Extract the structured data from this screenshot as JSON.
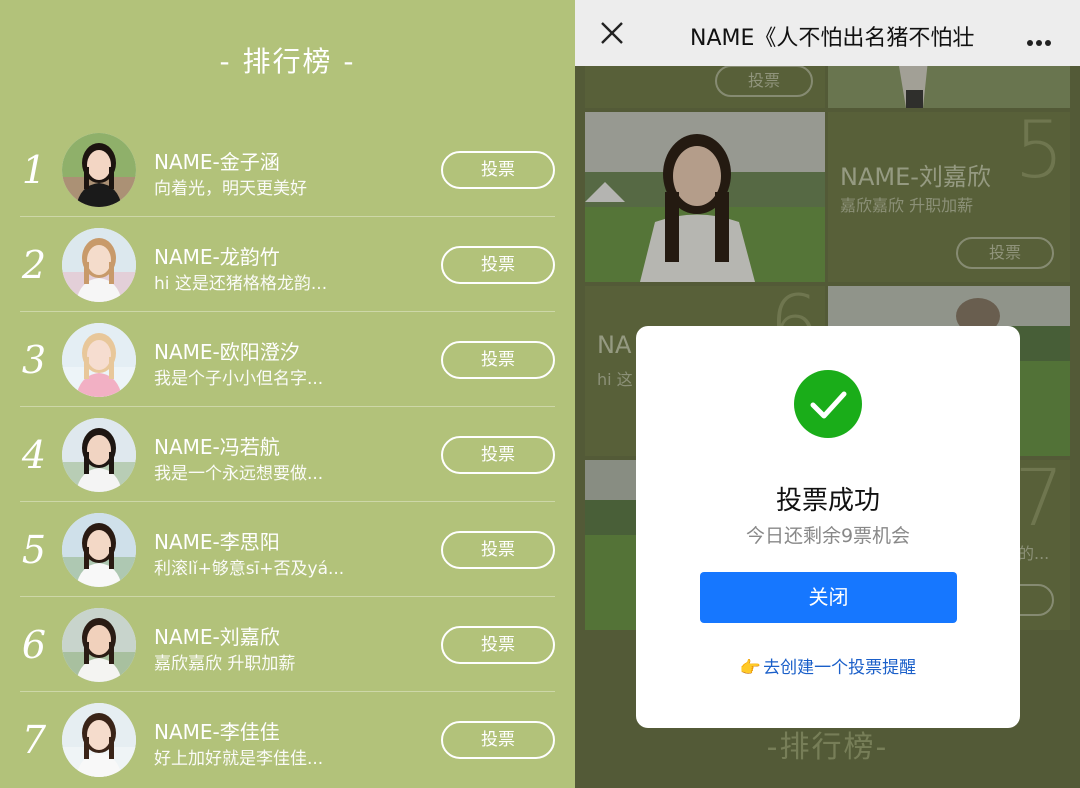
{
  "left": {
    "title": "- 排行榜 -",
    "vote_label": "投票",
    "rows": [
      {
        "rank": "1",
        "name": "NAME-金子涵",
        "desc": "向着光，明天更美好"
      },
      {
        "rank": "2",
        "name": "NAME-龙韵竹",
        "desc": "hi 这是还猪格格龙韵..."
      },
      {
        "rank": "3",
        "name": "NAME-欧阳澄汐",
        "desc": "我是个子小小但名字..."
      },
      {
        "rank": "4",
        "name": "NAME-冯若航",
        "desc": "我是一个永远想要做..."
      },
      {
        "rank": "5",
        "name": "NAME-李思阳",
        "desc": "利滚lǐ+够意sī+否及yá..."
      },
      {
        "rank": "6",
        "name": "NAME-刘嘉欣",
        "desc": "嘉欣嘉欣 升职加薪"
      },
      {
        "rank": "7",
        "name": "NAME-李佳佳",
        "desc": "好上加好就是李佳佳..."
      }
    ]
  },
  "right": {
    "topbar_title": "NAME《人不怕出名猪不怕壮",
    "cards": {
      "top_btn": "投票",
      "c5_num": "5",
      "c5_name": "NAME-刘嘉欣",
      "c5_desc": "嘉欣嘉欣 升职加薪",
      "c5_btn": "投票",
      "c6_num": "6",
      "c6_name": "NA",
      "c6_desc": "hi 这",
      "c7_num": "7",
      "c7_desc": "的..."
    },
    "bottom_title": "-排行榜-"
  },
  "modal": {
    "title": "投票成功",
    "subtitle": "今日还剩余9票机会",
    "close_label": "关闭",
    "link_text": "去创建一个投票提醒",
    "link_icon": "👉"
  },
  "colors": {
    "left_bg": "#b2c27a",
    "accent_blue": "#1677ff",
    "success_green": "#1aad19"
  }
}
